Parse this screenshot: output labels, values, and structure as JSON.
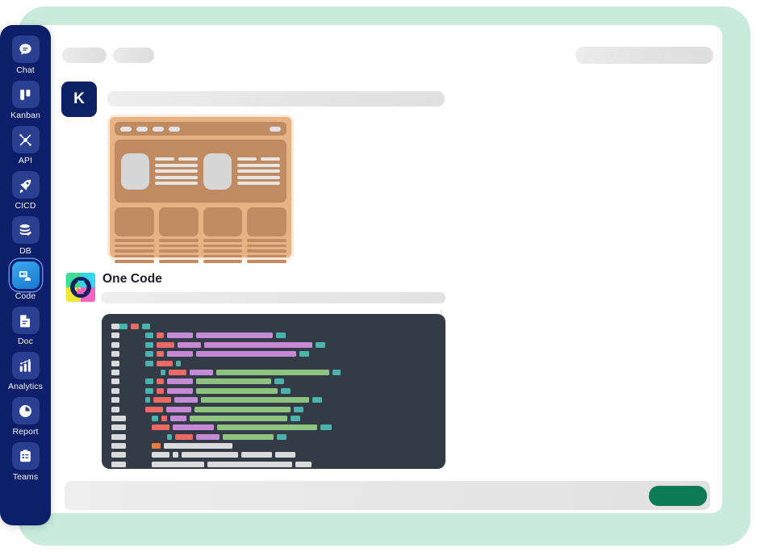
{
  "theme": {
    "backdrop": "#c9ebdd",
    "panel": "#ffffff",
    "sidebar": "#0d1f6b",
    "sidebar_icon": "#2b3f90",
    "active_accent": "#1878d4",
    "avatar_bg": "#0d2262",
    "mockup_fill": "#e8b384",
    "mockup_inner": "#c08a62",
    "code_bg": "#333b47",
    "send_green": "#0b7a55",
    "placeholder_grey": "#e6e6e6"
  },
  "sidebar": {
    "items": [
      {
        "label": "Chat",
        "icon": "chat-bubble-icon",
        "active": false
      },
      {
        "label": "Kanban",
        "icon": "kanban-board-icon",
        "active": false
      },
      {
        "label": "API",
        "icon": "api-plug-icon",
        "active": false
      },
      {
        "label": "CICD",
        "icon": "rocket-icon",
        "active": false
      },
      {
        "label": "DB",
        "icon": "database-icon",
        "active": false
      },
      {
        "label": "Code",
        "icon": "code-card-icon",
        "active": true
      },
      {
        "label": "Doc",
        "icon": "document-icon",
        "active": false
      },
      {
        "label": "Analytics",
        "icon": "bar-chart-icon",
        "active": false
      },
      {
        "label": "Report",
        "icon": "pie-chart-icon",
        "active": false
      },
      {
        "label": "Teams",
        "icon": "clipboard-icon",
        "active": false
      }
    ]
  },
  "toolbar": {
    "chips": [
      "",
      ""
    ],
    "right_chip": ""
  },
  "message": {
    "avatar_initial": "K",
    "text_placeholder": ""
  },
  "mockup": {
    "window_dots": 4,
    "hero_blocks": 2,
    "card_count": 4,
    "card_text_lines": 5
  },
  "assistant": {
    "title": "One Code",
    "logo_quadrants": [
      "#3ddc97",
      "#36d5ef",
      "#f0e636",
      "#f763c0"
    ],
    "logo_mark_color": "#12205e",
    "subtitle_placeholder": ""
  },
  "code_block": {
    "language_hint": "",
    "palette": {
      "teal": "#4bb3ac",
      "red": "#ec6a66",
      "purple": "#c58ad6",
      "green": "#8dc27f",
      "orange": "#f2793f",
      "grey": "#d9dadc"
    },
    "lines": [
      {
        "gutter": "s",
        "indent": 0,
        "tokens": [
          [
            "teal",
            10
          ],
          [
            "red",
            10
          ],
          [
            "teal",
            10
          ]
        ]
      },
      {
        "gutter": "s",
        "indent": 32,
        "tokens": [
          [
            "teal",
            10
          ],
          [
            "red",
            9
          ],
          [
            "purple",
            32
          ],
          [
            "purple",
            95
          ],
          [
            "teal",
            12
          ]
        ]
      },
      {
        "gutter": "s",
        "indent": 32,
        "tokens": [
          [
            "teal",
            10
          ],
          [
            "red",
            22
          ],
          [
            "purple",
            29
          ],
          [
            "purple",
            134
          ],
          [
            "teal",
            12
          ]
        ]
      },
      {
        "gutter": "s",
        "indent": 32,
        "tokens": [
          [
            "teal",
            10
          ],
          [
            "red",
            9
          ],
          [
            "purple",
            32
          ],
          [
            "purple",
            124
          ],
          [
            "teal",
            12
          ]
        ]
      },
      {
        "gutter": "s",
        "indent": 32,
        "tokens": [
          [
            "teal",
            10
          ],
          [
            "red",
            20
          ],
          [
            "teal",
            6
          ]
        ]
      },
      {
        "gutter": "s",
        "indent": 51,
        "tokens": [
          [
            "teal",
            6
          ],
          [
            "red",
            22
          ],
          [
            "purple",
            29
          ],
          [
            "green",
            140
          ],
          [
            "teal",
            10
          ]
        ]
      },
      {
        "gutter": "s",
        "indent": 32,
        "tokens": [
          [
            "teal",
            10
          ],
          [
            "red",
            9
          ],
          [
            "purple",
            32
          ],
          [
            "green",
            93
          ],
          [
            "teal",
            12
          ]
        ]
      },
      {
        "gutter": "s",
        "indent": 32,
        "tokens": [
          [
            "teal",
            10
          ],
          [
            "red",
            9
          ],
          [
            "purple",
            32
          ],
          [
            "green",
            101
          ],
          [
            "teal",
            12
          ]
        ]
      },
      {
        "gutter": "s",
        "indent": 32,
        "tokens": [
          [
            "teal",
            6
          ],
          [
            "red",
            22
          ],
          [
            "purple",
            29
          ],
          [
            "green",
            134
          ],
          [
            "teal",
            12
          ]
        ]
      },
      {
        "gutter": "s",
        "indent": 32,
        "tokens": [
          [
            "red",
            22
          ],
          [
            "purple",
            31
          ],
          [
            "green",
            119
          ],
          [
            "teal",
            12
          ]
        ]
      },
      {
        "gutter": "w",
        "indent": 32,
        "tokens": [
          [
            "teal",
            8
          ],
          [
            "red",
            7
          ],
          [
            "purple",
            20
          ],
          [
            "green",
            121
          ],
          [
            "teal",
            12
          ]
        ]
      },
      {
        "gutter": "w",
        "indent": 32,
        "tokens": [
          [
            "red",
            22
          ],
          [
            "purple",
            51
          ],
          [
            "green",
            124
          ],
          [
            "teal",
            14
          ]
        ]
      },
      {
        "gutter": "w",
        "indent": 51,
        "tokens": [
          [
            "teal",
            6
          ],
          [
            "red",
            22
          ],
          [
            "purple",
            29
          ],
          [
            "green",
            63
          ],
          [
            "teal",
            12
          ]
        ]
      },
      {
        "gutter": "w",
        "indent": 32,
        "tokens": [
          [
            "orange",
            11
          ],
          [
            "grey",
            85
          ]
        ]
      },
      {
        "gutter": "w",
        "indent": 32,
        "tokens": [
          [
            "grey",
            22
          ],
          [
            "grey",
            7
          ],
          [
            "grey",
            70
          ],
          [
            "grey",
            38
          ],
          [
            "grey",
            25
          ]
        ]
      },
      {
        "gutter": "w",
        "indent": 32,
        "tokens": [
          [
            "grey",
            65
          ],
          [
            "grey",
            105
          ],
          [
            "grey",
            20
          ]
        ]
      }
    ]
  },
  "composer": {
    "input_placeholder": "",
    "send_label": ""
  }
}
